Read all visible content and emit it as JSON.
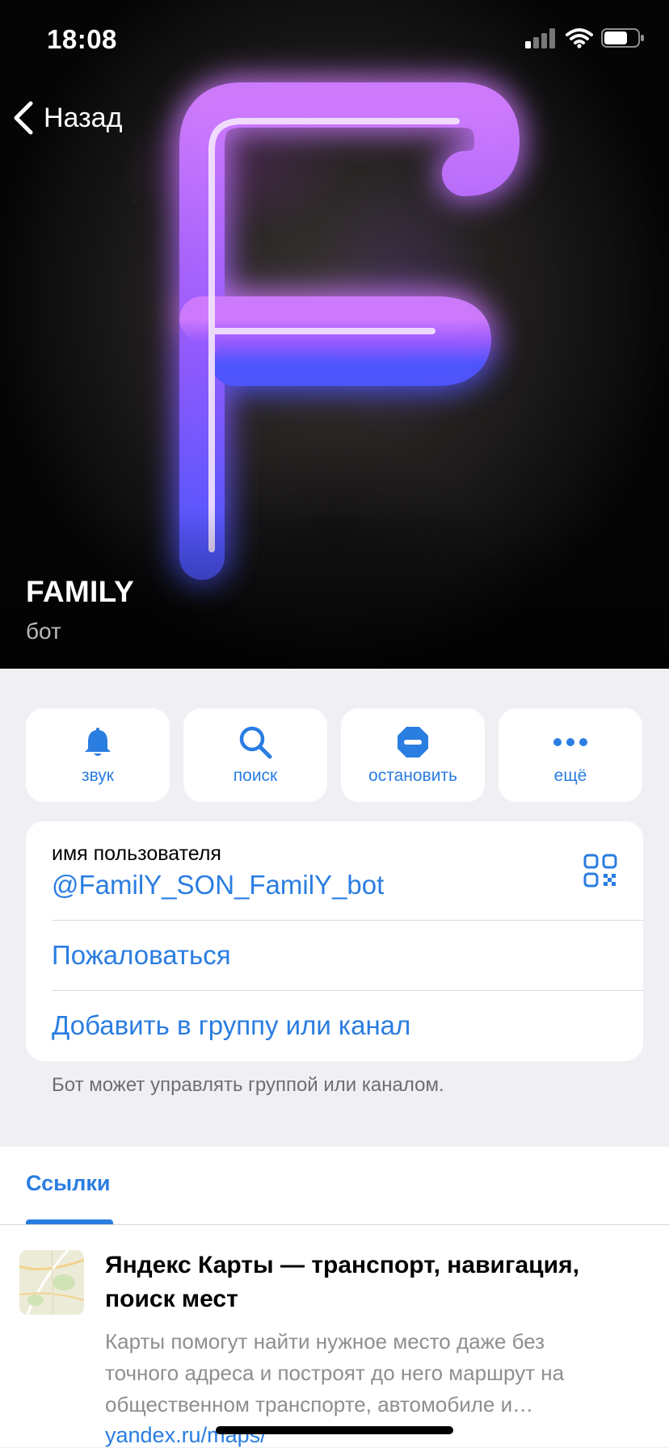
{
  "status_bar": {
    "time": "18:08"
  },
  "nav": {
    "back_label": "Назад"
  },
  "profile": {
    "name": "FAMILY",
    "subtitle": "бот"
  },
  "actions": [
    {
      "label": "звук",
      "icon": "bell-icon"
    },
    {
      "label": "поиск",
      "icon": "search-icon"
    },
    {
      "label": "остановить",
      "icon": "stop-icon"
    },
    {
      "label": "ещё",
      "icon": "more-icon"
    }
  ],
  "info": {
    "username_caption": "имя пользователя",
    "username": "@FamilY_SON_FamilY_bot",
    "report": "Пожаловаться",
    "add_to_group": "Добавить в группу или канал",
    "footnote": "Бот может управлять группой или каналом."
  },
  "links": {
    "tab_label": "Ссылки",
    "item": {
      "title": "Яндекс Карты — транспорт, навигация, поиск мест",
      "description": "Карты помогут найти нужное место даже без точного адреса и построят до него маршрут на общественном транспорте, автомобиле и…",
      "url": "yandex.ru/maps/"
    }
  },
  "colors": {
    "accent": "#2a7de1",
    "background": "#efeff4",
    "neon_purple": "#b85cff",
    "neon_blue": "#5a5cff"
  }
}
